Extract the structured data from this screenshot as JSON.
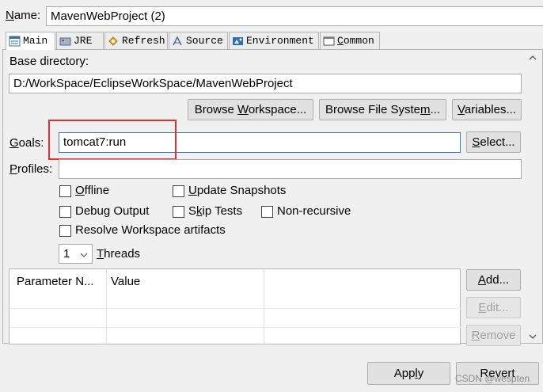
{
  "name": {
    "label": "Name:",
    "value": "MavenWebProject (2)"
  },
  "tabs": [
    {
      "label": "Main",
      "icon": "main-tab-icon",
      "active": true
    },
    {
      "label": "JRE",
      "icon": "jre-icon"
    },
    {
      "label": "Refresh",
      "icon": "refresh-icon"
    },
    {
      "label": "Source",
      "icon": "source-icon"
    },
    {
      "label": "Environment",
      "icon": "environment-icon"
    },
    {
      "label": "Common",
      "icon": "common-icon"
    }
  ],
  "main": {
    "base_directory_label": "Base directory:",
    "base_directory_value": "D:/WorkSpace/EclipseWorkSpace/MavenWebProject",
    "browse_workspace": "Browse Workspace...",
    "browse_file_system": "Browse File System...",
    "variables": "Variables...",
    "goals_label": "Goals:",
    "goals_value": "tomcat7:run",
    "select": "Select...",
    "profiles_label": "Profiles:",
    "profiles_value": "",
    "checkboxes": {
      "offline": "Offline",
      "update_snapshots": "Update Snapshots",
      "debug_output": "Debug Output",
      "skip_tests": "Skip Tests",
      "non_recursive": "Non-recursive",
      "resolve_workspace": "Resolve Workspace artifacts"
    },
    "threads_value": "1",
    "threads_label": "Threads",
    "table": {
      "columns": [
        "Parameter N...",
        "Value"
      ]
    },
    "add": "Add...",
    "edit": "Edit...",
    "remove": "Remove"
  },
  "footer": {
    "apply": "Apply",
    "revert": "Revert"
  },
  "watermark": "CSDN @wespten",
  "colors": {
    "highlight_box": "#e03030",
    "focus_border": "#3c7fb1"
  }
}
